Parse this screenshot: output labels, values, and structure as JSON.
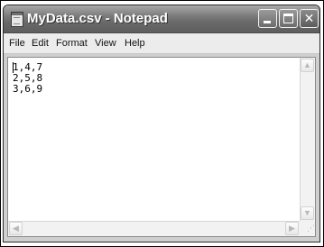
{
  "window": {
    "title": "MyData.csv - Notepad",
    "icon": "notepad-icon"
  },
  "menu": {
    "items": [
      {
        "label": "File"
      },
      {
        "label": "Edit"
      },
      {
        "label": "Format"
      },
      {
        "label": "View"
      },
      {
        "label": "Help"
      }
    ]
  },
  "document": {
    "content": "1,4,7\n2,5,8\n3,6,9"
  },
  "scrollbars": {
    "up_glyph": "▲",
    "down_glyph": "▼",
    "left_glyph": "◀",
    "right_glyph": "▶",
    "grip_glyph": "⋰"
  }
}
